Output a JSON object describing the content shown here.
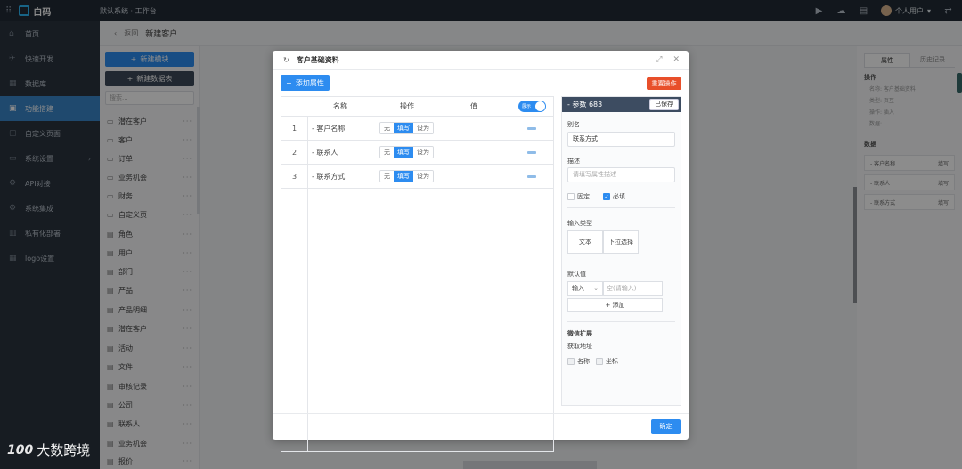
{
  "topbar": {
    "brand": "白码",
    "crumb": "默认系统 · 工作台",
    "user": "个人用户"
  },
  "sidebar": {
    "items": [
      {
        "label": "首页",
        "icon": "home-icon"
      },
      {
        "label": "快速开发",
        "icon": "rocket-icon"
      },
      {
        "label": "数据库",
        "icon": "database-icon"
      },
      {
        "label": "功能搭建",
        "icon": "build-icon",
        "active": true
      },
      {
        "label": "自定义页面",
        "icon": "page-icon"
      },
      {
        "label": "系统设置",
        "icon": "settings-icon"
      },
      {
        "label": "API对接",
        "icon": "api-icon"
      },
      {
        "label": "系统集成",
        "icon": "integration-icon"
      },
      {
        "label": "私有化部署",
        "icon": "deploy-icon"
      },
      {
        "label": "logo设置",
        "icon": "logo-settings-icon"
      }
    ]
  },
  "breadcrumb": {
    "back": "返回",
    "title": "新建客户"
  },
  "tree": {
    "new_module": "新建模块",
    "new_table": "新建数据表",
    "search_placeholder": "搜索...",
    "items": [
      {
        "label": "潜在客户",
        "type": "folder"
      },
      {
        "label": "客户",
        "type": "folder"
      },
      {
        "label": "订单",
        "type": "folder"
      },
      {
        "label": "业务机会",
        "type": "folder"
      },
      {
        "label": "财务",
        "type": "folder"
      },
      {
        "label": "自定义页",
        "type": "folder"
      },
      {
        "label": "角色",
        "type": "file"
      },
      {
        "label": "用户",
        "type": "file"
      },
      {
        "label": "部门",
        "type": "file"
      },
      {
        "label": "产品",
        "type": "file"
      },
      {
        "label": "产品明细",
        "type": "file"
      },
      {
        "label": "潜在客户",
        "type": "file"
      },
      {
        "label": "活动",
        "type": "file"
      },
      {
        "label": "文件",
        "type": "file"
      },
      {
        "label": "审核记录",
        "type": "file"
      },
      {
        "label": "公司",
        "type": "file"
      },
      {
        "label": "联系人",
        "type": "file"
      },
      {
        "label": "业务机会",
        "type": "file"
      },
      {
        "label": "报价",
        "type": "file"
      }
    ]
  },
  "right_panel": {
    "tab_props": "属性",
    "tab_history": "历史记录",
    "section_op": "操作",
    "op_lines": [
      "名称: 客户基础资料",
      "类型: 页互",
      "操作: 插入",
      "数据:"
    ],
    "section_data": "数据",
    "data_rows": [
      {
        "name": "- 客户名称",
        "op": "填写"
      },
      {
        "name": "- 联系人",
        "op": "填写"
      },
      {
        "name": "- 联系方式",
        "op": "填写"
      }
    ]
  },
  "modal": {
    "title": "客户基础资料",
    "add_button": "添加属性",
    "reset_button": "重置操作",
    "ok_button": "确定",
    "table": {
      "col_name": "名称",
      "col_op": "操作",
      "col_value": "值",
      "toggle_label": "展示",
      "op_options": [
        "无",
        "填写",
        "设为"
      ],
      "rows": [
        {
          "num": "1",
          "name": "- 客户名称",
          "selected": "填写"
        },
        {
          "num": "2",
          "name": "- 联系人",
          "selected": "填写"
        },
        {
          "num": "3",
          "name": "- 联系方式",
          "selected": "填写"
        }
      ]
    },
    "param": {
      "header": "- 参数 683",
      "saved": "已保存",
      "alias_label": "别名",
      "alias_value": "联系方式",
      "desc_label": "描述",
      "desc_placeholder": "请填写属性描述",
      "fixed_label": "固定",
      "required_label": "必填",
      "input_type_label": "输入类型",
      "type_text": "文本",
      "type_dropdown": "下拉选择",
      "default_label": "默认值",
      "default_select": "输入",
      "default_placeholder": "空(请输入)",
      "add_value": "+ 添加",
      "wechat_label": "微信扩展",
      "get_location": "获取地址",
      "name_label": "名称",
      "coord_label": "坐标"
    }
  },
  "watermark": {
    "logo": "100",
    "text": "大数跨境"
  }
}
